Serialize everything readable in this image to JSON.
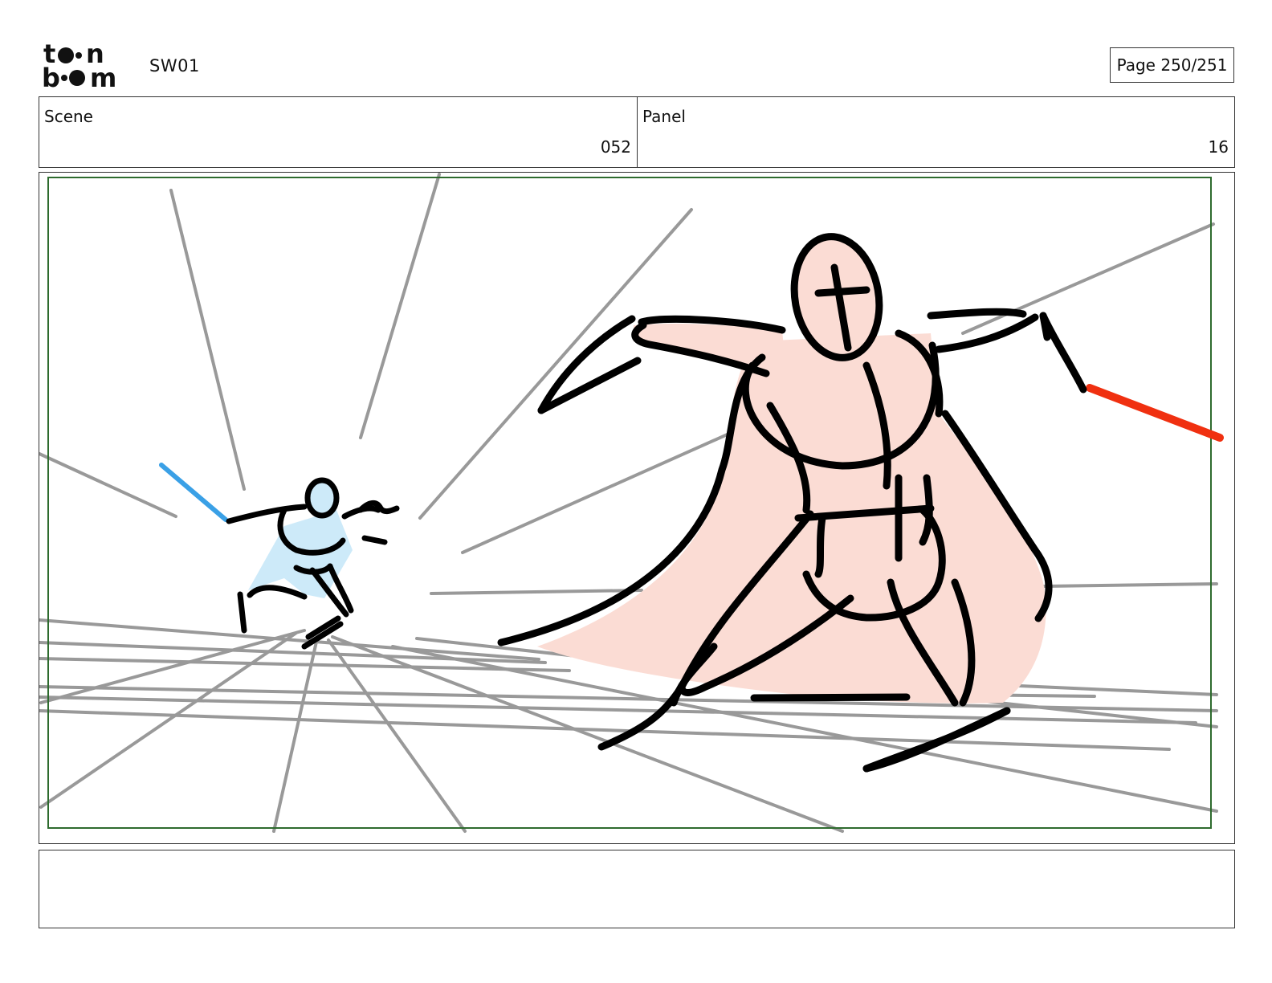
{
  "header": {
    "logo_text": "toon boom",
    "project_code": "SW01",
    "page_indicator": "Page 250/251"
  },
  "info": {
    "scene_label": "Scene",
    "scene_value": "052",
    "panel_label": "Panel",
    "panel_value": "16"
  },
  "frame": {
    "safe_area_color": "#2e6b2e",
    "perspective_line_color": "#999999",
    "ink_color": "#000000",
    "hero_fill": "#cdeaf9",
    "hero_saber_color": "#3aa0e6",
    "villain_fill": "#fbdcd4",
    "villain_saber_color": "#f03010"
  },
  "caption": {
    "text": ""
  }
}
